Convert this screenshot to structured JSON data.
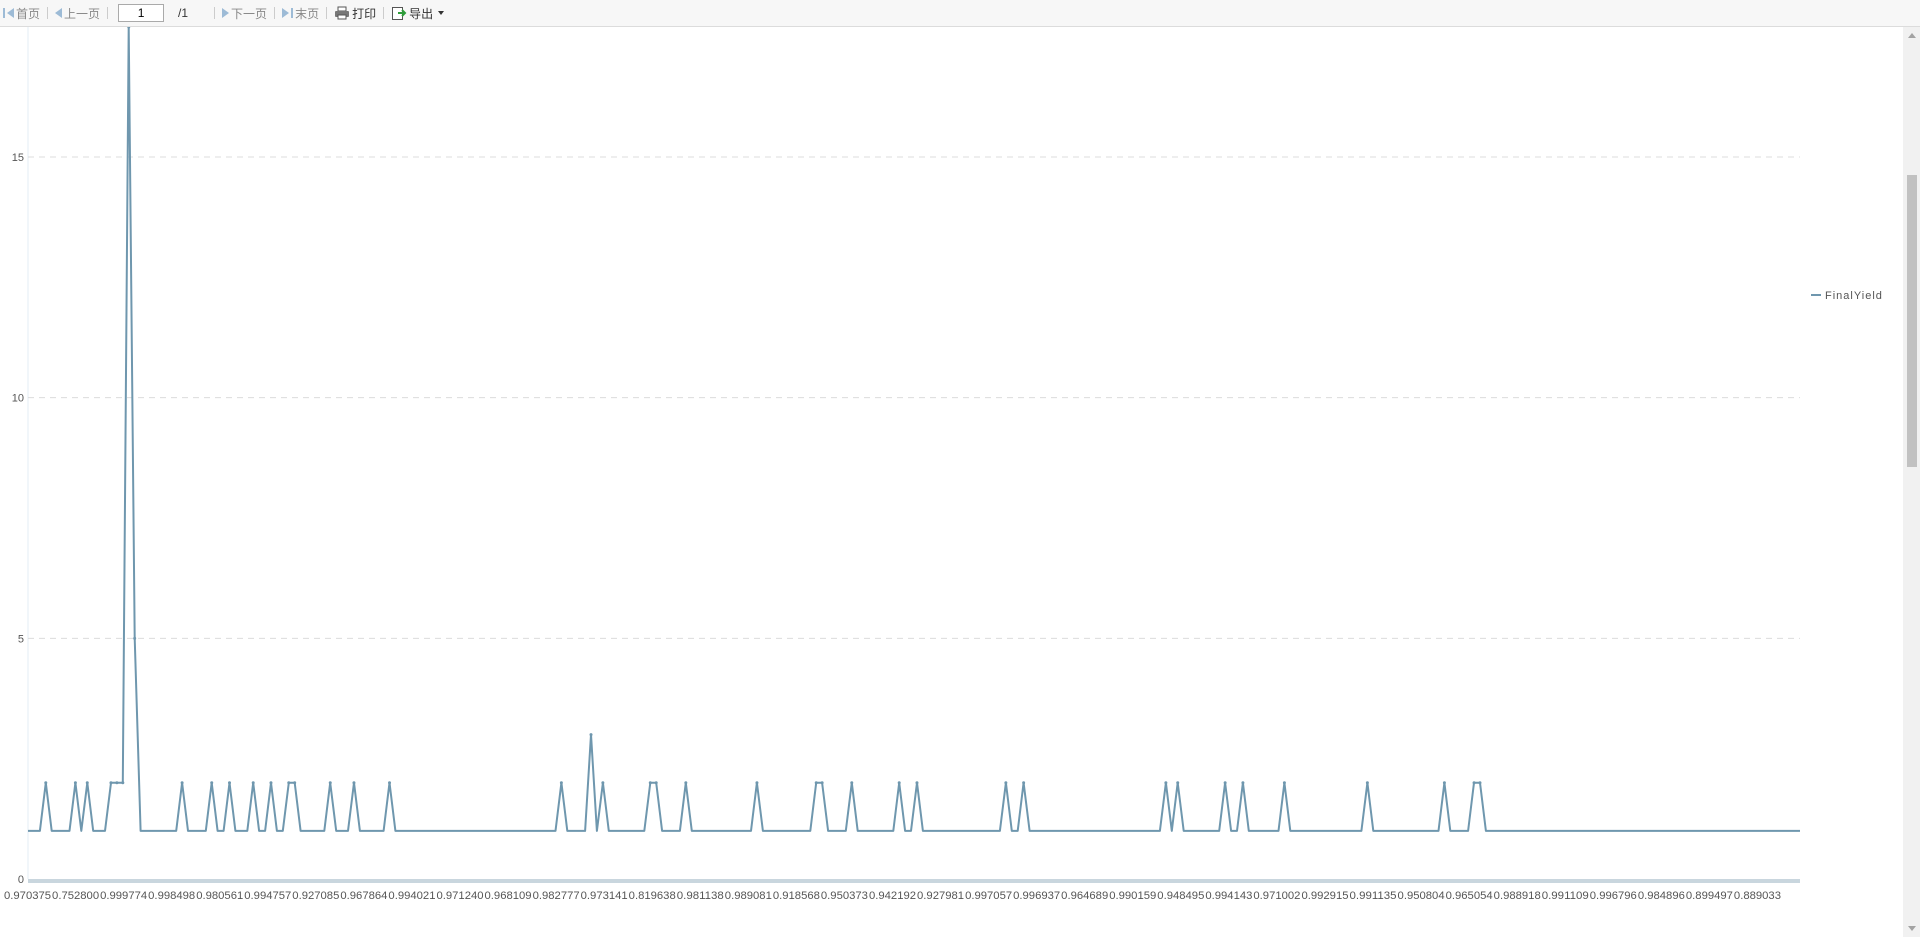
{
  "toolbar": {
    "first_label": "首页",
    "prev_label": "上一页",
    "page_value": "1",
    "page_total": "/1",
    "next_label": "下一页",
    "last_label": "末页",
    "print_label": "打印",
    "export_label": "导出"
  },
  "colors": {
    "series": "#6f97ae",
    "grid": "#dcdcdc",
    "axis_text": "#555555"
  },
  "chart_data": {
    "type": "line",
    "title": "",
    "xlabel": "",
    "ylabel": "",
    "ylim": [
      0,
      17.7
    ],
    "yticks": [
      0,
      5,
      10,
      15
    ],
    "grid": "horizontal dashed",
    "legend": "right",
    "x_tick_labels": [
      "0.970375",
      "0.752800",
      "0.999774",
      "0.998498",
      "0.980561",
      "0.994757",
      "0.927085",
      "0.967864",
      "0.994021",
      "0.971240",
      "0.968109",
      "0.982777",
      "0.973141",
      "0.819638",
      "0.981138",
      "0.989081",
      "0.918568",
      "0.950373",
      "0.942192",
      "0.927981",
      "0.997057",
      "0.996937",
      "0.964689",
      "0.990159",
      "0.948495",
      "0.994143",
      "0.971002",
      "0.992915",
      "0.991135",
      "0.950804",
      "0.965054",
      "0.988918",
      "0.991109",
      "0.996796",
      "0.984896",
      "0.899497",
      "0.889033"
    ],
    "n_points": 300,
    "baseline": 1,
    "series": [
      {
        "name": "FinalYield",
        "baseline": 1,
        "spikes": [
          {
            "index": 3,
            "value": 2
          },
          {
            "index": 8,
            "value": 2
          },
          {
            "index": 10,
            "value": 2
          },
          {
            "index": 14,
            "value": 2
          },
          {
            "index": 15,
            "value": 2
          },
          {
            "index": 16,
            "value": 2
          },
          {
            "index": 17,
            "value": 17.7
          },
          {
            "index": 18,
            "value": 5
          },
          {
            "index": 26,
            "value": 2
          },
          {
            "index": 31,
            "value": 2
          },
          {
            "index": 34,
            "value": 2
          },
          {
            "index": 38,
            "value": 2
          },
          {
            "index": 41,
            "value": 2
          },
          {
            "index": 44,
            "value": 2
          },
          {
            "index": 45,
            "value": 2
          },
          {
            "index": 51,
            "value": 2
          },
          {
            "index": 55,
            "value": 2
          },
          {
            "index": 61,
            "value": 2
          },
          {
            "index": 90,
            "value": 2
          },
          {
            "index": 95,
            "value": 3
          },
          {
            "index": 97,
            "value": 2
          },
          {
            "index": 105,
            "value": 2
          },
          {
            "index": 106,
            "value": 2
          },
          {
            "index": 111,
            "value": 2
          },
          {
            "index": 123,
            "value": 2
          },
          {
            "index": 133,
            "value": 2
          },
          {
            "index": 134,
            "value": 2
          },
          {
            "index": 139,
            "value": 2
          },
          {
            "index": 147,
            "value": 2
          },
          {
            "index": 150,
            "value": 2
          },
          {
            "index": 165,
            "value": 2
          },
          {
            "index": 168,
            "value": 2
          },
          {
            "index": 192,
            "value": 2
          },
          {
            "index": 194,
            "value": 2
          },
          {
            "index": 202,
            "value": 2
          },
          {
            "index": 205,
            "value": 2
          },
          {
            "index": 212,
            "value": 2
          },
          {
            "index": 226,
            "value": 2
          },
          {
            "index": 239,
            "value": 2
          },
          {
            "index": 244,
            "value": 2
          },
          {
            "index": 245,
            "value": 2
          }
        ]
      }
    ]
  }
}
